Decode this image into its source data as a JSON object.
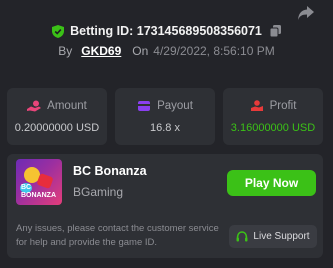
{
  "header": {
    "betting_id_label": "Betting ID: 173145689508356071",
    "by_label": "By",
    "username": "GKD69",
    "on_label": "On",
    "datetime": "4/29/2022, 8:56:10 PM",
    "icons": [
      "share-icon",
      "shield-check-icon",
      "copy-icon"
    ]
  },
  "stats": [
    {
      "label": "Amount",
      "value": "0.20000000 USD",
      "icon": "amount-icon",
      "color": "#e8457a"
    },
    {
      "label": "Payout",
      "value": "16.8 x",
      "icon": "payout-icon",
      "color": "#8a3ff0"
    },
    {
      "label": "Profit",
      "value": "3.16000000 USD",
      "icon": "profit-icon",
      "color": "#e83a3a",
      "value_color": "#3bc117"
    }
  ],
  "game": {
    "thumb_text": "BC BONANZA",
    "title": "BC Bonanza",
    "provider": "BGaming",
    "play_label": "Play Now",
    "issue_text": "Any issues, please contact the customer service for help and provide the game ID.",
    "support_label": "Live Support"
  },
  "colors": {
    "background": "#232429",
    "card": "#2e3035",
    "accent_green": "#3bc117"
  }
}
